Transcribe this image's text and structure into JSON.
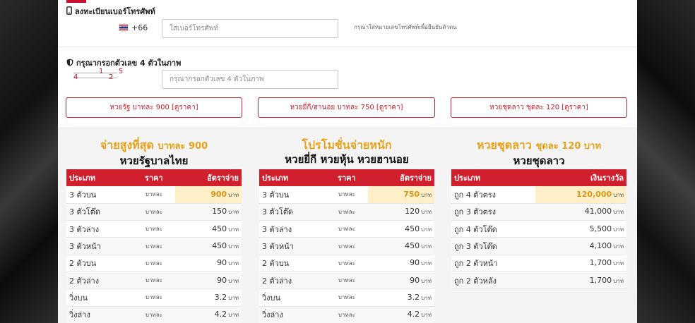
{
  "phone": {
    "title": "ลงทะเบียนเบอร์โทรศัพท์",
    "dial_code": "+66",
    "placeholder": "ใส่เบอร์โทรศัพท์",
    "hint": "กรุณาใส่หมายเลขโทรศัพท์เพื่อยืนยันตัวตน"
  },
  "captcha": {
    "title": "กรุณากรอกตัวเลข 4 ตัวในภาพ",
    "digits": [
      "4",
      "1",
      "2",
      "5"
    ],
    "placeholder": "กรุณากรอกตัวเลข 4 ตัวในภาพ"
  },
  "buttons": [
    "หวยรัฐ บาทละ 900 [ดูราคา]",
    "หวยยี่กี/ฮานอย บาทละ 750 [ดูราคา]",
    "หวยชุดลาว ชุดละ 120 [ดูราคา]"
  ],
  "columns": [
    {
      "head_line1": "จ่ายสูงที่สุด",
      "head_line1_small": "บาทละ 900",
      "head_line2": "หวยรัฐบาลไทย",
      "headers": [
        "ประเภท",
        "ราคา",
        "อัตราจ่าย"
      ],
      "rows": [
        [
          "3 ตัวบน",
          "บาทละ",
          "900",
          "บาท"
        ],
        [
          "3 ตัวโต๊ด",
          "บาทละ",
          "150",
          "บาท"
        ],
        [
          "3 ตัวล่าง",
          "บาทละ",
          "450",
          "บาท"
        ],
        [
          "3 ตัวหน้า",
          "บาทละ",
          "450",
          "บาท"
        ],
        [
          "2 ตัวบน",
          "บาทละ",
          "90",
          "บาท"
        ],
        [
          "2 ตัวล่าง",
          "บาทละ",
          "90",
          "บาท"
        ],
        [
          "วิ่งบน",
          "บาทละ",
          "3.2",
          "บาท"
        ],
        [
          "วิ่งล่าง",
          "บาทละ",
          "4.2",
          "บาท"
        ]
      ]
    },
    {
      "head_line1": "โปรโมชั่นจ่ายหนัก",
      "head_line1_small": "",
      "head_line2": "หวยยี่กี หวยหุ้น หวยฮานอย",
      "headers": [
        "ประเภท",
        "ราคา",
        "อัตราจ่าย"
      ],
      "rows": [
        [
          "3 ตัวบน",
          "บาทละ",
          "750",
          "บาท"
        ],
        [
          "3 ตัวโต๊ด",
          "บาทละ",
          "120",
          "บาท"
        ],
        [
          "3 ตัวล่าง",
          "บาทละ",
          "450",
          "บาท"
        ],
        [
          "3 ตัวหน้า",
          "บาทละ",
          "450",
          "บาท"
        ],
        [
          "2 ตัวบน",
          "บาทละ",
          "90",
          "บาท"
        ],
        [
          "2 ตัวล่าง",
          "บาทละ",
          "90",
          "บาท"
        ],
        [
          "วิ่งบน",
          "บาทละ",
          "3.2",
          "บาท"
        ],
        [
          "วิ่งล่าง",
          "บาทละ",
          "4.2",
          "บาท"
        ]
      ]
    },
    {
      "head_line1": "หวยชุดลาว",
      "head_line1_small": "ชุดละ 120 บาท",
      "head_line2": "หวยชุดลาว",
      "headers": [
        "ประเภท",
        "เงินรางวัล"
      ],
      "rows": [
        [
          "ถูก 4 ตัวตรง",
          "120,000",
          "บาท"
        ],
        [
          "ถูก 3 ตัวตรง",
          "41,000",
          "บาท"
        ],
        [
          "ถูก 4 ตัวโต๊ด",
          "5,500",
          "บาท"
        ],
        [
          "ถูก 3 ตัวโต๊ด",
          "4,100",
          "บาท"
        ],
        [
          "ถูก 2 ตัวหน้า",
          "1,700",
          "บาท"
        ],
        [
          "ถูก 2 ตัวหลัง",
          "1,700",
          "บาท"
        ]
      ]
    }
  ],
  "colors": {
    "accent": "#d0202e",
    "gold": "#e8a21a",
    "highlight": "#fdf0c8"
  }
}
